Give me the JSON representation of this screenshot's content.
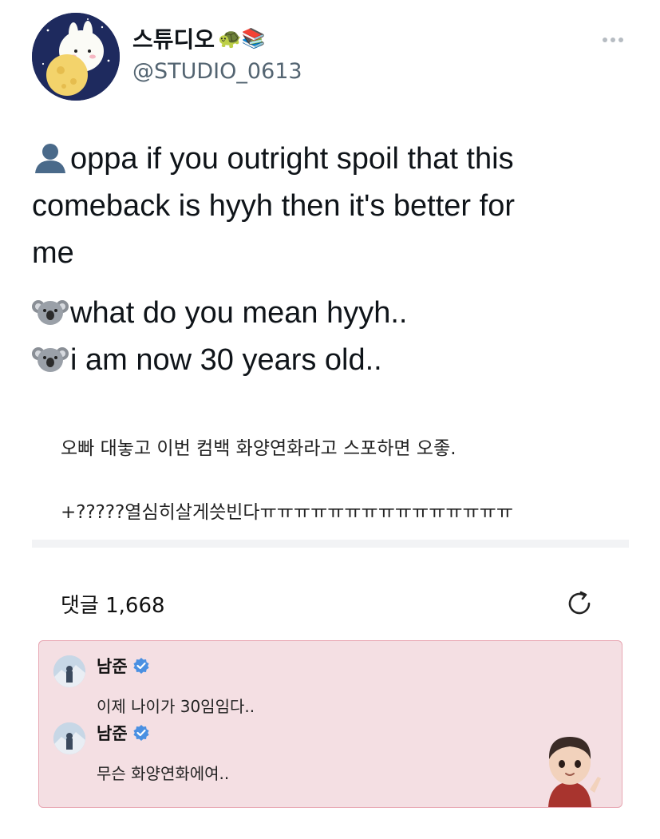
{
  "author": {
    "display_name": "스튜디오",
    "display_emojis": "🐢📚",
    "handle": "@STUDIO_0613"
  },
  "tweet": {
    "line1": "oppa if you outright spoil that this",
    "line2": "comeback is hyyh then it's better for",
    "line3": "me",
    "line4": "what do you mean hyyh..",
    "line5": "i am now 30 years old..",
    "icons": [
      "bust-in-silhouette-icon",
      "koala-icon",
      "koala-icon"
    ]
  },
  "korean": {
    "line1": "오빠 대놓고 이번 컴백 화양연화라고 스포하면 오좋.",
    "line2": "+?????열심히살게씃빈다ㅠㅠㅠㅠㅠㅠㅠㅠㅠㅠㅠㅠㅠㅠㅠ"
  },
  "comments": {
    "label": "댓글 1,668"
  },
  "replies": [
    {
      "name": "남준",
      "text": "이제 나이가 30임임다.."
    },
    {
      "name": "남준",
      "text": "무슨 화양연화에여.."
    }
  ],
  "colors": {
    "verified": "#4a90e2",
    "reply_bg": "#f4dfe3",
    "reply_border": "#e8a7b3",
    "handle": "#536471"
  }
}
